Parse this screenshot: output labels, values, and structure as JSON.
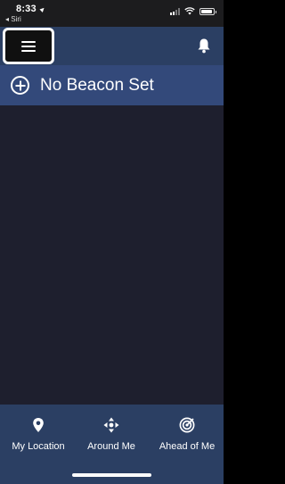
{
  "status_bar": {
    "time": "8:33",
    "back_label": "◂ Siri",
    "battery_level": 0.9
  },
  "header": {
    "menu_icon": "hamburger-icon",
    "bell_icon": "bell-icon"
  },
  "beacon": {
    "icon": "plus-circle-icon",
    "label": "No Beacon Set"
  },
  "tabs": [
    {
      "label": "My Location",
      "icon": "location-pin-icon"
    },
    {
      "label": "Around Me",
      "icon": "arrows-around-icon"
    },
    {
      "label": "Ahead of Me",
      "icon": "radar-ahead-icon"
    }
  ],
  "colors": {
    "header_bg": "#2b3f63",
    "beacon_bg": "#33497a",
    "main_bg": "#1e1f2e"
  }
}
